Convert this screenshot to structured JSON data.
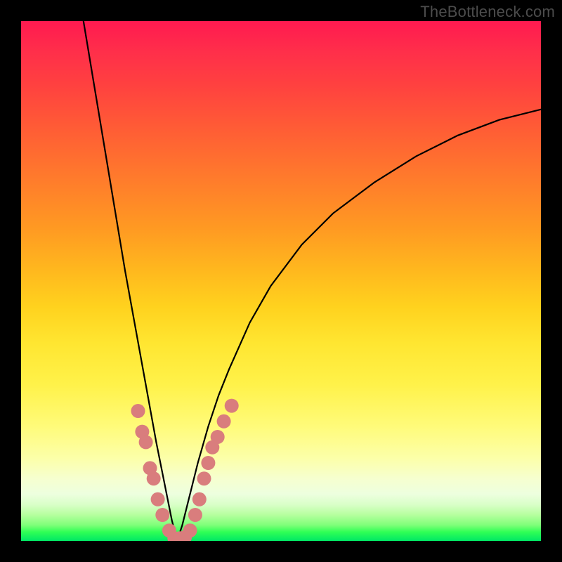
{
  "watermark": "TheBottleneck.com",
  "chart_data": {
    "type": "line",
    "title": "",
    "xlabel": "",
    "ylabel": "",
    "xlim": [
      0,
      100
    ],
    "ylim": [
      0,
      100
    ],
    "notes": "V-shaped bottleneck curve on a red→green gradient; minimum near x≈30. Salmon dots cluster along the curve near the trough (x≈22–41, y≤25). Axes/ticks not shown.",
    "series": [
      {
        "name": "bottleneck-curve",
        "x": [
          12,
          14,
          16,
          18,
          20,
          22,
          24,
          26,
          27,
          28,
          29,
          30,
          31,
          32,
          33,
          34,
          36,
          38,
          40,
          44,
          48,
          54,
          60,
          68,
          76,
          84,
          92,
          100
        ],
        "y": [
          100,
          88,
          76,
          64,
          52,
          41,
          30,
          19,
          14,
          9,
          4,
          0,
          3,
          7,
          11,
          15,
          22,
          28,
          33,
          42,
          49,
          57,
          63,
          69,
          74,
          78,
          81,
          83
        ]
      }
    ],
    "dots": {
      "name": "highlight-dots",
      "color": "#d97d7d",
      "points": [
        {
          "x": 22.5,
          "y": 25.0
        },
        {
          "x": 23.3,
          "y": 21.0
        },
        {
          "x": 24.0,
          "y": 19.0
        },
        {
          "x": 24.8,
          "y": 14.0
        },
        {
          "x": 25.5,
          "y": 12.0
        },
        {
          "x": 26.3,
          "y": 8.0
        },
        {
          "x": 27.2,
          "y": 5.0
        },
        {
          "x": 28.5,
          "y": 2.0
        },
        {
          "x": 29.5,
          "y": 0.5
        },
        {
          "x": 30.5,
          "y": 0.5
        },
        {
          "x": 31.5,
          "y": 0.7
        },
        {
          "x": 32.5,
          "y": 2.0
        },
        {
          "x": 33.5,
          "y": 5.0
        },
        {
          "x": 34.3,
          "y": 8.0
        },
        {
          "x": 35.2,
          "y": 12.0
        },
        {
          "x": 36.0,
          "y": 15.0
        },
        {
          "x": 36.8,
          "y": 18.0
        },
        {
          "x": 37.8,
          "y": 20.0
        },
        {
          "x": 39.0,
          "y": 23.0
        },
        {
          "x": 40.5,
          "y": 26.0
        }
      ]
    },
    "gradient_stops": [
      {
        "pct": 0,
        "color": "#ff1a50"
      },
      {
        "pct": 50,
        "color": "#ffd21e"
      },
      {
        "pct": 90,
        "color": "#f6ffcf"
      },
      {
        "pct": 100,
        "color": "#00e765"
      }
    ]
  }
}
